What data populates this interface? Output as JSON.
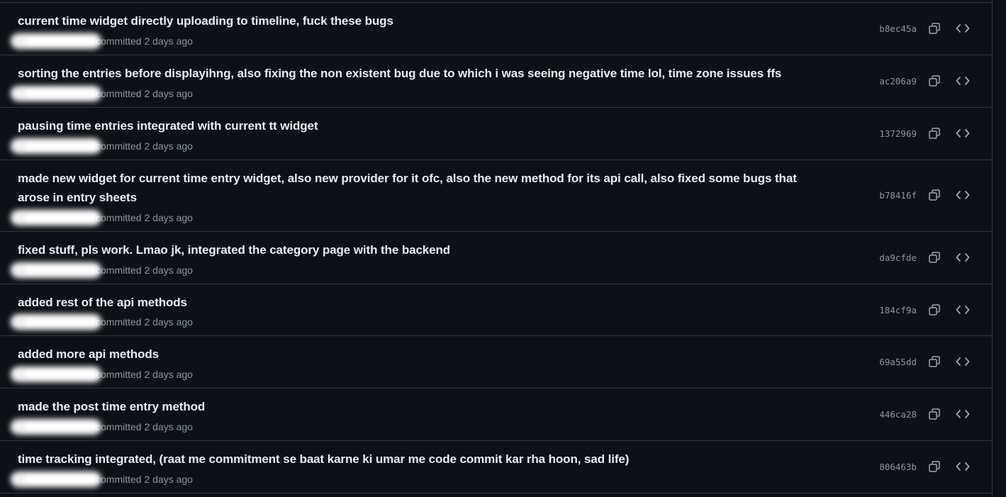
{
  "commits": [
    {
      "title": "current time widget directly uploading to timeline, fuck these bugs",
      "meta": "committed 2 days ago",
      "sha": "b8ec45a"
    },
    {
      "title": "sorting the entries before displayihng, also fixing the non existent bug due to which i was seeing negative time lol, time zone issues ffs",
      "meta": "committed 2 days ago",
      "sha": "ac206a9"
    },
    {
      "title": "pausing time entries integrated with current tt widget",
      "meta": "committed 2 days ago",
      "sha": "1372969"
    },
    {
      "title": "made new widget for current time entry widget, also new provider for it ofc, also the new method for its api call, also fixed some bugs that arose in entry sheets",
      "meta": "committed 2 days ago",
      "sha": "b78416f"
    },
    {
      "title": "fixed stuff, pls work. Lmao jk, integrated the category page with the backend",
      "meta": "committed 2 days ago",
      "sha": "da9cfde"
    },
    {
      "title": "added rest of the api methods",
      "meta": "committed 2 days ago",
      "sha": "184cf9a"
    },
    {
      "title": "added more api methods",
      "meta": "committed 2 days ago",
      "sha": "69a55dd"
    },
    {
      "title": "made the post time entry method",
      "meta": "committed 2 days ago",
      "sha": "446ca28"
    },
    {
      "title": "time tracking integrated, (raat me commitment se baat karne ki umar me code commit kar rha hoon, sad life)",
      "meta": "committed 2 days ago",
      "sha": "806463b"
    }
  ],
  "icons": {
    "copy": "copy-icon",
    "browse": "code-icon"
  },
  "colors": {
    "background": "#0d1117",
    "border": "#30363d",
    "title": "#e6edf3",
    "muted": "#8b949e"
  }
}
